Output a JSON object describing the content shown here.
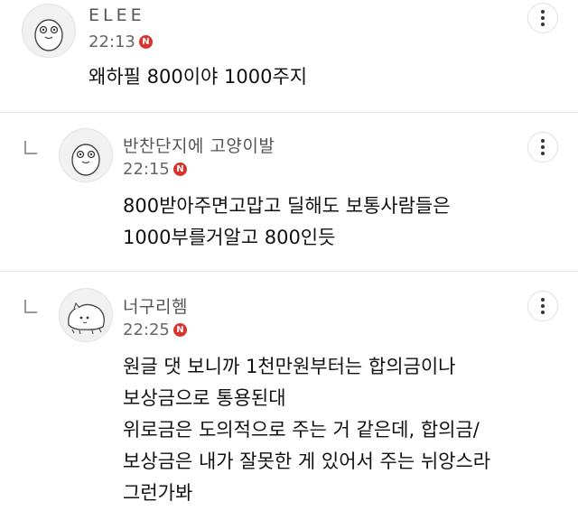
{
  "comments": [
    {
      "author": "ELEE",
      "time": "22:13",
      "badge": "N",
      "lines": [
        "왜하필 800이야 1000주지"
      ]
    },
    {
      "author": "반찬단지에 고양이발",
      "time": "22:15",
      "badge": "N",
      "lines": [
        "800받아주면고맙고 딜해도 보통사람들은",
        "1000부를거알고 800인듯"
      ]
    },
    {
      "author": "너구리헴",
      "time": "22:25",
      "badge": "N",
      "lines": [
        "원글 댓 보니까 1천만원부터는 합의금이나",
        "보상금으로 통용된대",
        "위로금은 도의적으로 주는 거 같은데, 합의금/",
        "보상금은 내가 잘못한 게 있어서 주는 뉘앙스라",
        "그런가봐"
      ]
    }
  ]
}
